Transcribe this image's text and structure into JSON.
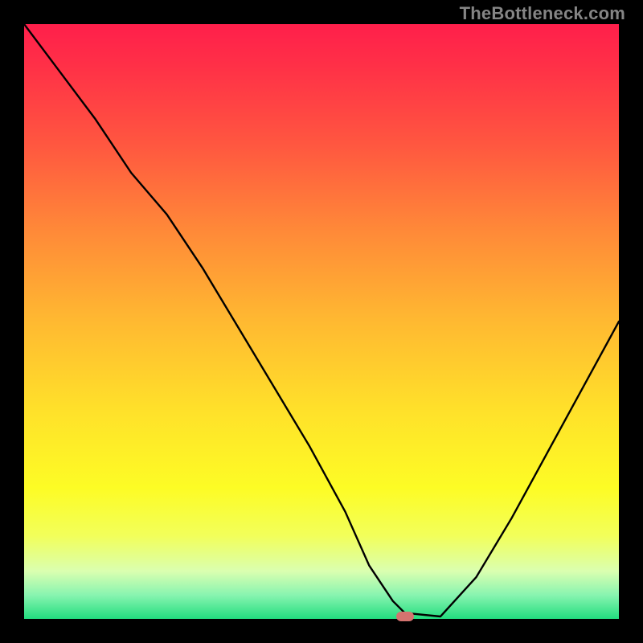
{
  "watermark": "TheBottleneck.com",
  "colors": {
    "frame": "#000000",
    "marker": "#d4736f",
    "gradient_top": "#ff1f4b",
    "gradient_bottom": "#22dd7f",
    "curve": "#000000"
  },
  "chart_data": {
    "type": "line",
    "title": "",
    "xlabel": "",
    "ylabel": "",
    "xlim": [
      0,
      100
    ],
    "ylim": [
      0,
      100
    ],
    "grid": false,
    "legend": false,
    "x": [
      0,
      6,
      12,
      18,
      24,
      30,
      36,
      42,
      48,
      54,
      58,
      62,
      64,
      70,
      76,
      82,
      88,
      94,
      100
    ],
    "values": [
      100,
      92,
      84,
      75,
      68,
      59,
      49,
      39,
      29,
      18,
      9,
      3,
      1,
      0.4,
      7,
      17,
      28,
      39,
      50
    ],
    "marker": {
      "x": 64,
      "y": 0.4
    },
    "annotations": []
  }
}
